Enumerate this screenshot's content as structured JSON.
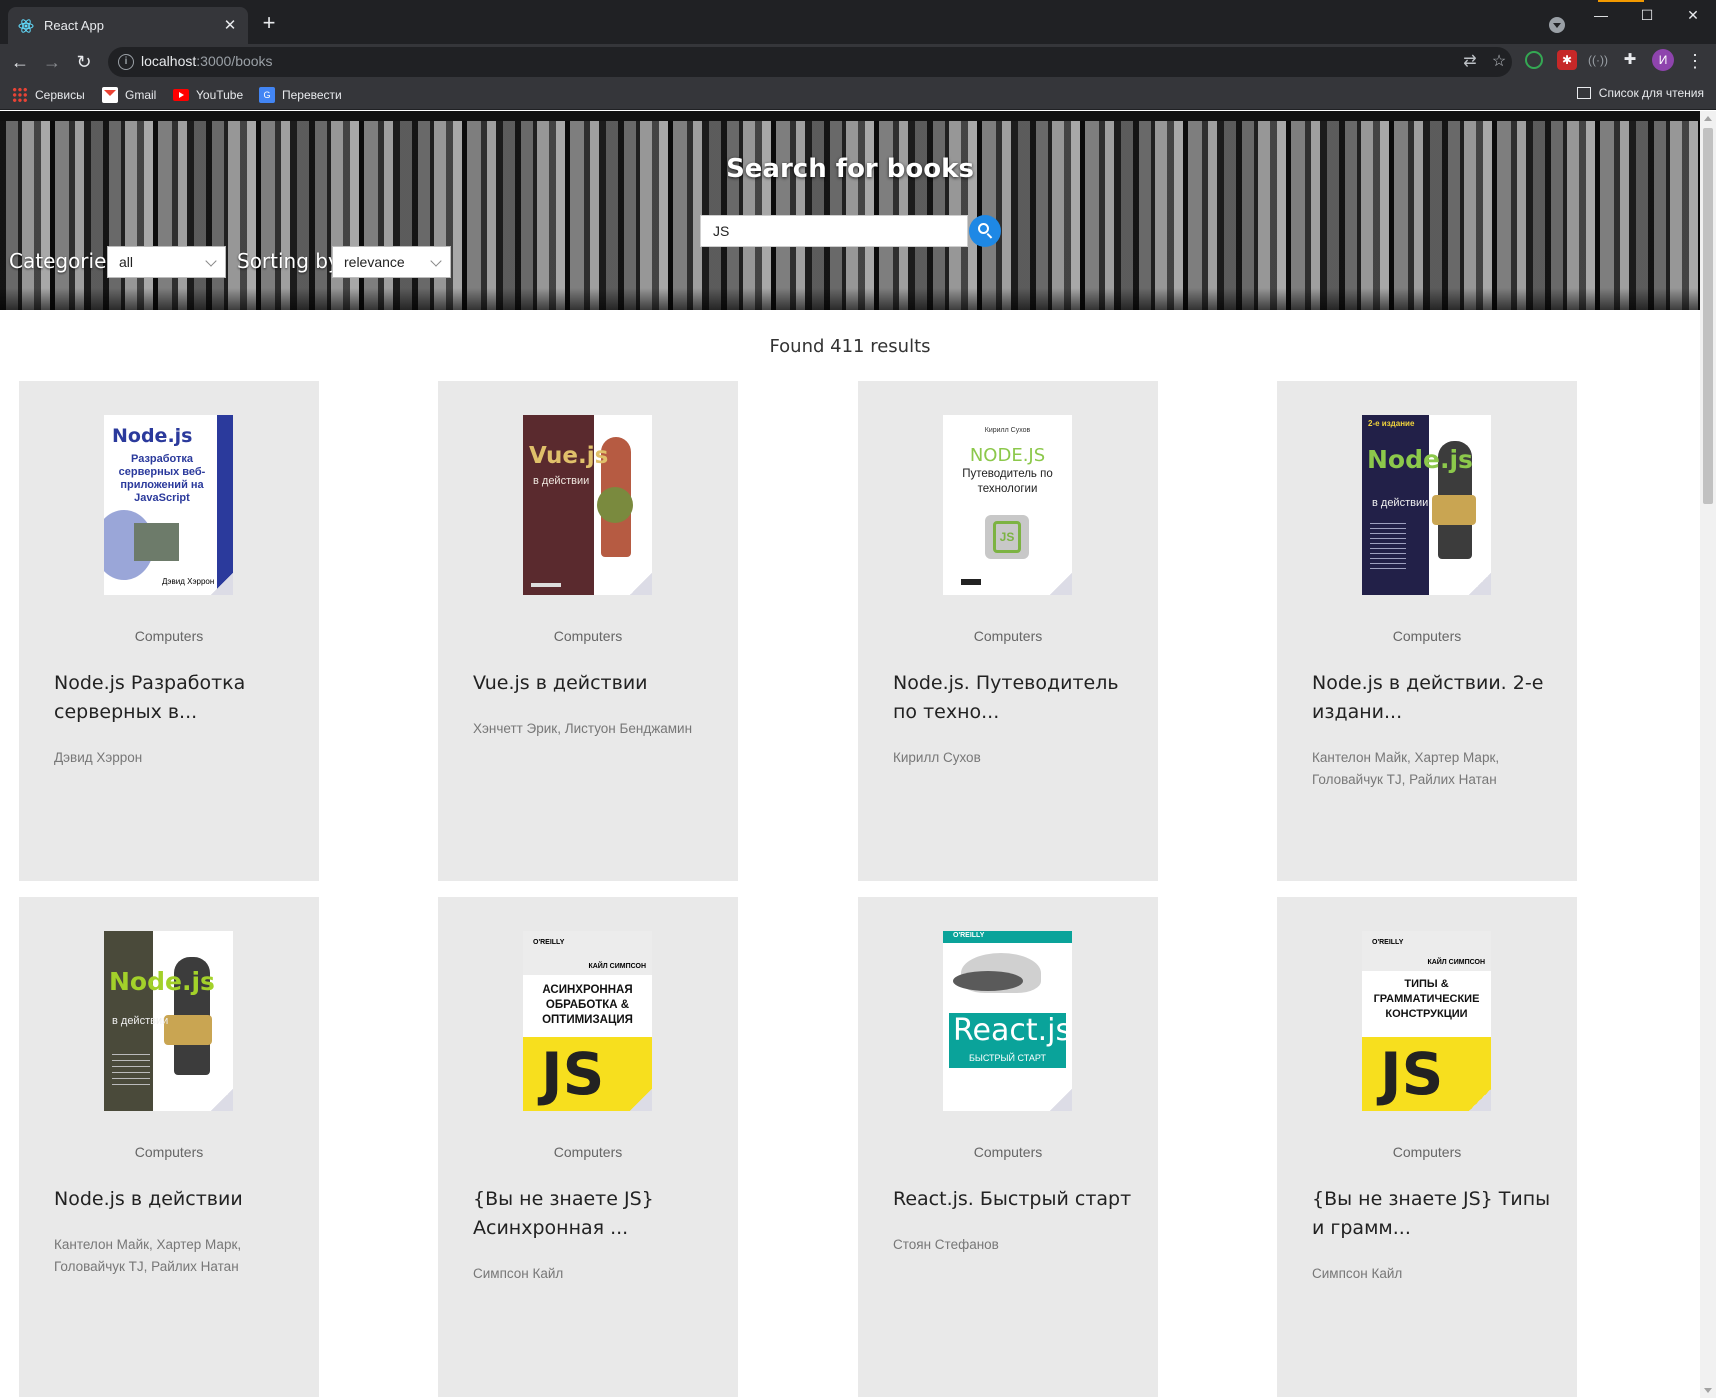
{
  "browser": {
    "tab_title": "React App",
    "url_host": "localhost",
    "url_path": ":3000/books",
    "bookmarks": [
      "Сервисы",
      "Gmail",
      "YouTube",
      "Перевести"
    ],
    "reading_list": "Список для чтения",
    "profile_initial": "И"
  },
  "hero": {
    "title": "Search for books",
    "search_value": "JS",
    "categories_label": "Categories",
    "categories_value": "all",
    "sorting_label": "Sorting by",
    "sorting_value": "relevance"
  },
  "results": {
    "found_text": "Found 411 results"
  },
  "books": [
    {
      "category": "Computers",
      "title": "Node.js Разработка серверных в...",
      "authors": "Дэвид Хэррон",
      "cover": {
        "bg": "#ffffff",
        "accent": "#2b3a9c",
        "big": "Node.js",
        "sub": "Разработка серверных веб-приложений на JavaScript",
        "bottom": "Дэвид Хэррон"
      }
    },
    {
      "category": "Computers",
      "title": "Vue.js в действии",
      "authors": "Хэнчетт Эрик, Листуон Бенджамин",
      "cover": {
        "bg": "#5a2a2e",
        "accent": "#e0c06a",
        "big": "Vue.js",
        "sub": "в действии",
        "bottom": ""
      }
    },
    {
      "category": "Computers",
      "title": "Node.js. Путеводитель по техно...",
      "authors": "Кирилл Сухов",
      "cover": {
        "bg": "#ffffff",
        "accent": "#8cc84b",
        "big": "NODE.JS",
        "sub": "Путеводитель по технологии",
        "top": "Кирилл Сухов"
      }
    },
    {
      "category": "Computers",
      "title": "Node.js в действии. 2-е издани...",
      "authors": "Кантелон Майк, Хартер Марк, Головайчук TJ, Райлих Натан",
      "cover": {
        "bg": "#222048",
        "accent": "#8cc84b",
        "big": "Node.js",
        "sub": "в действии",
        "top": "2-е издание"
      }
    },
    {
      "category": "Computers",
      "title": "Node.js в действии",
      "authors": "Кантелон Майк, Хартер Марк, Головайчук TJ, Райлих Натан",
      "cover": {
        "bg": "#4a4a3a",
        "accent": "#a3d12a",
        "big": "Node.js",
        "sub": "в действии",
        "bottom": ""
      }
    },
    {
      "category": "Computers",
      "title": "{Вы не знаете JS} Асинхронная ...",
      "authors": "Симпсон Кайл",
      "cover": {
        "bg": "#ffffff",
        "accent": "#f7df1e",
        "big": "АСИНХРОННАЯ ОБРАБОТКА & ОПТИМИЗАЦИЯ",
        "sub": "КАЙЛ СИМПСОН",
        "top": "O'REILLY"
      }
    },
    {
      "category": "Computers",
      "title": "React.js. Быстрый старт",
      "authors": "Стоян Стефанов",
      "cover": {
        "bg": "#ffffff",
        "accent": "#0aa39a",
        "big": "React.js",
        "sub": "БЫСТРЫЙ СТАРТ",
        "top": "O'REILLY"
      }
    },
    {
      "category": "Computers",
      "title": "{Вы не знаете JS} Типы и грамм...",
      "authors": "Симпсон Кайл",
      "cover": {
        "bg": "#ffffff",
        "accent": "#f7df1e",
        "big": "ТИПЫ & ГРАММАТИЧЕСКИЕ КОНСТРУКЦИИ",
        "sub": "КАЙЛ СИМПСОН",
        "top": "O'REILLY"
      }
    }
  ]
}
